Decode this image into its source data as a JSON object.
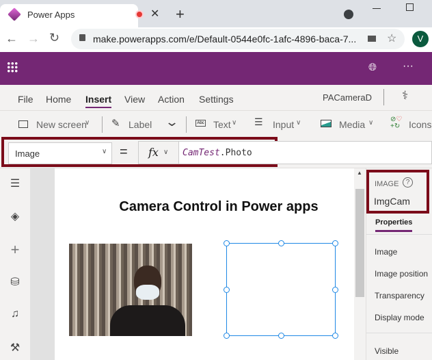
{
  "browser": {
    "tab_title": "Power Apps",
    "url": "make.powerapps.com/e/Default-0544e0fc-1afc-4896-baca-7...",
    "profile_initial": "V"
  },
  "menu": {
    "items": [
      "File",
      "Home",
      "Insert",
      "View",
      "Action",
      "Settings"
    ],
    "active": "Insert",
    "app_name": "PACameraD"
  },
  "toolbar": {
    "new_screen": "New screen",
    "label": "Label",
    "text": "Text",
    "input": "Input",
    "media": "Media",
    "icons": "Icons"
  },
  "formula": {
    "property": "Image",
    "equals": "=",
    "fx": "fx",
    "expression_object": "CamTest",
    "expression_rest": ".Photo"
  },
  "canvas": {
    "title": "Camera Control in Power apps"
  },
  "panel": {
    "type": "IMAGE",
    "help": "?",
    "control_name": "ImgCam",
    "tab": "Properties",
    "properties": [
      "Image",
      "Image position",
      "Transparency",
      "Display mode",
      "Visible"
    ]
  },
  "colors": {
    "brand": "#742774",
    "highlight": "#7b0c1a",
    "selection": "#1e88e5"
  }
}
